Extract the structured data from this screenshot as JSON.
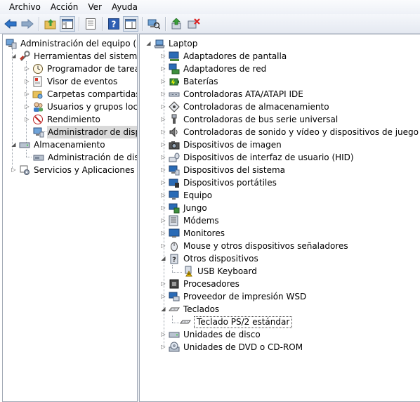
{
  "menu": [
    "Archivo",
    "Acción",
    "Ver",
    "Ayuda"
  ],
  "toolbar": {
    "buttons": [
      "back-icon",
      "forward-icon",
      "up-folder-icon",
      "show-hide-tree-icon",
      "properties-icon",
      "help-icon",
      "show-action-pane-icon",
      "scan-hardware-icon",
      "update-driver-icon",
      "uninstall-icon"
    ]
  },
  "left_tree": [
    {
      "label": "Administración del equipo (loc",
      "icon": "computer-management-icon"
    },
    {
      "label": "Herramientas del sistema",
      "icon": "system-tools-icon"
    },
    {
      "label": "Programador de tareas",
      "icon": "task-scheduler-icon"
    },
    {
      "label": "Visor de eventos",
      "icon": "event-viewer-icon"
    },
    {
      "label": "Carpetas compartidas",
      "icon": "shared-folders-icon"
    },
    {
      "label": "Usuarios y grupos locale",
      "icon": "users-groups-icon"
    },
    {
      "label": "Rendimiento",
      "icon": "performance-icon"
    },
    {
      "label": "Administrador de dispo",
      "icon": "device-manager-icon"
    },
    {
      "label": "Almacenamiento",
      "icon": "storage-icon"
    },
    {
      "label": "Administración de disco",
      "icon": "disk-management-icon"
    },
    {
      "label": "Servicios y Aplicaciones",
      "icon": "services-apps-icon"
    }
  ],
  "device_tree": {
    "root": "Laptop",
    "categories": [
      {
        "label": "Adaptadores de pantalla",
        "icon": "display-adapter-icon"
      },
      {
        "label": "Adaptadores de red",
        "icon": "network-adapter-icon"
      },
      {
        "label": "Baterías",
        "icon": "battery-icon"
      },
      {
        "label": "Controladoras ATA/ATAPI IDE",
        "icon": "ide-controller-icon"
      },
      {
        "label": "Controladoras de almacenamiento",
        "icon": "storage-controller-icon"
      },
      {
        "label": "Controladoras de bus serie universal",
        "icon": "usb-controller-icon"
      },
      {
        "label": "Controladoras de sonido y vídeo y dispositivos de juego",
        "icon": "sound-icon"
      },
      {
        "label": "Dispositivos de imagen",
        "icon": "camera-icon"
      },
      {
        "label": "Dispositivos de interfaz de usuario (HID)",
        "icon": "hid-icon"
      },
      {
        "label": "Dispositivos del sistema",
        "icon": "system-device-icon"
      },
      {
        "label": "Dispositivos portátiles",
        "icon": "portable-device-icon"
      },
      {
        "label": "Equipo",
        "icon": "computer-icon"
      },
      {
        "label": "Jungo",
        "icon": "jungo-icon"
      },
      {
        "label": "Módems",
        "icon": "modem-icon"
      },
      {
        "label": "Monitores",
        "icon": "monitor-icon"
      },
      {
        "label": "Mouse y otros dispositivos señaladores",
        "icon": "mouse-icon"
      },
      {
        "label": "Otros dispositivos",
        "icon": "other-devices-icon"
      },
      {
        "label": "USB Keyboard",
        "icon": "warning-device-icon"
      },
      {
        "label": "Procesadores",
        "icon": "processor-icon"
      },
      {
        "label": "Proveedor de impresión WSD",
        "icon": "printer-icon"
      },
      {
        "label": "Teclados",
        "icon": "keyboard-icon"
      },
      {
        "label": "Teclado PS/2 estándar",
        "icon": "keyboard-icon"
      },
      {
        "label": "Unidades de disco",
        "icon": "disk-drive-icon"
      },
      {
        "label": "Unidades de DVD o CD-ROM",
        "icon": "dvd-icon"
      }
    ]
  },
  "colors": {
    "accent": "#3c7fb1",
    "selection_gray": "#d9d9d9",
    "warning": "#f2c200"
  }
}
